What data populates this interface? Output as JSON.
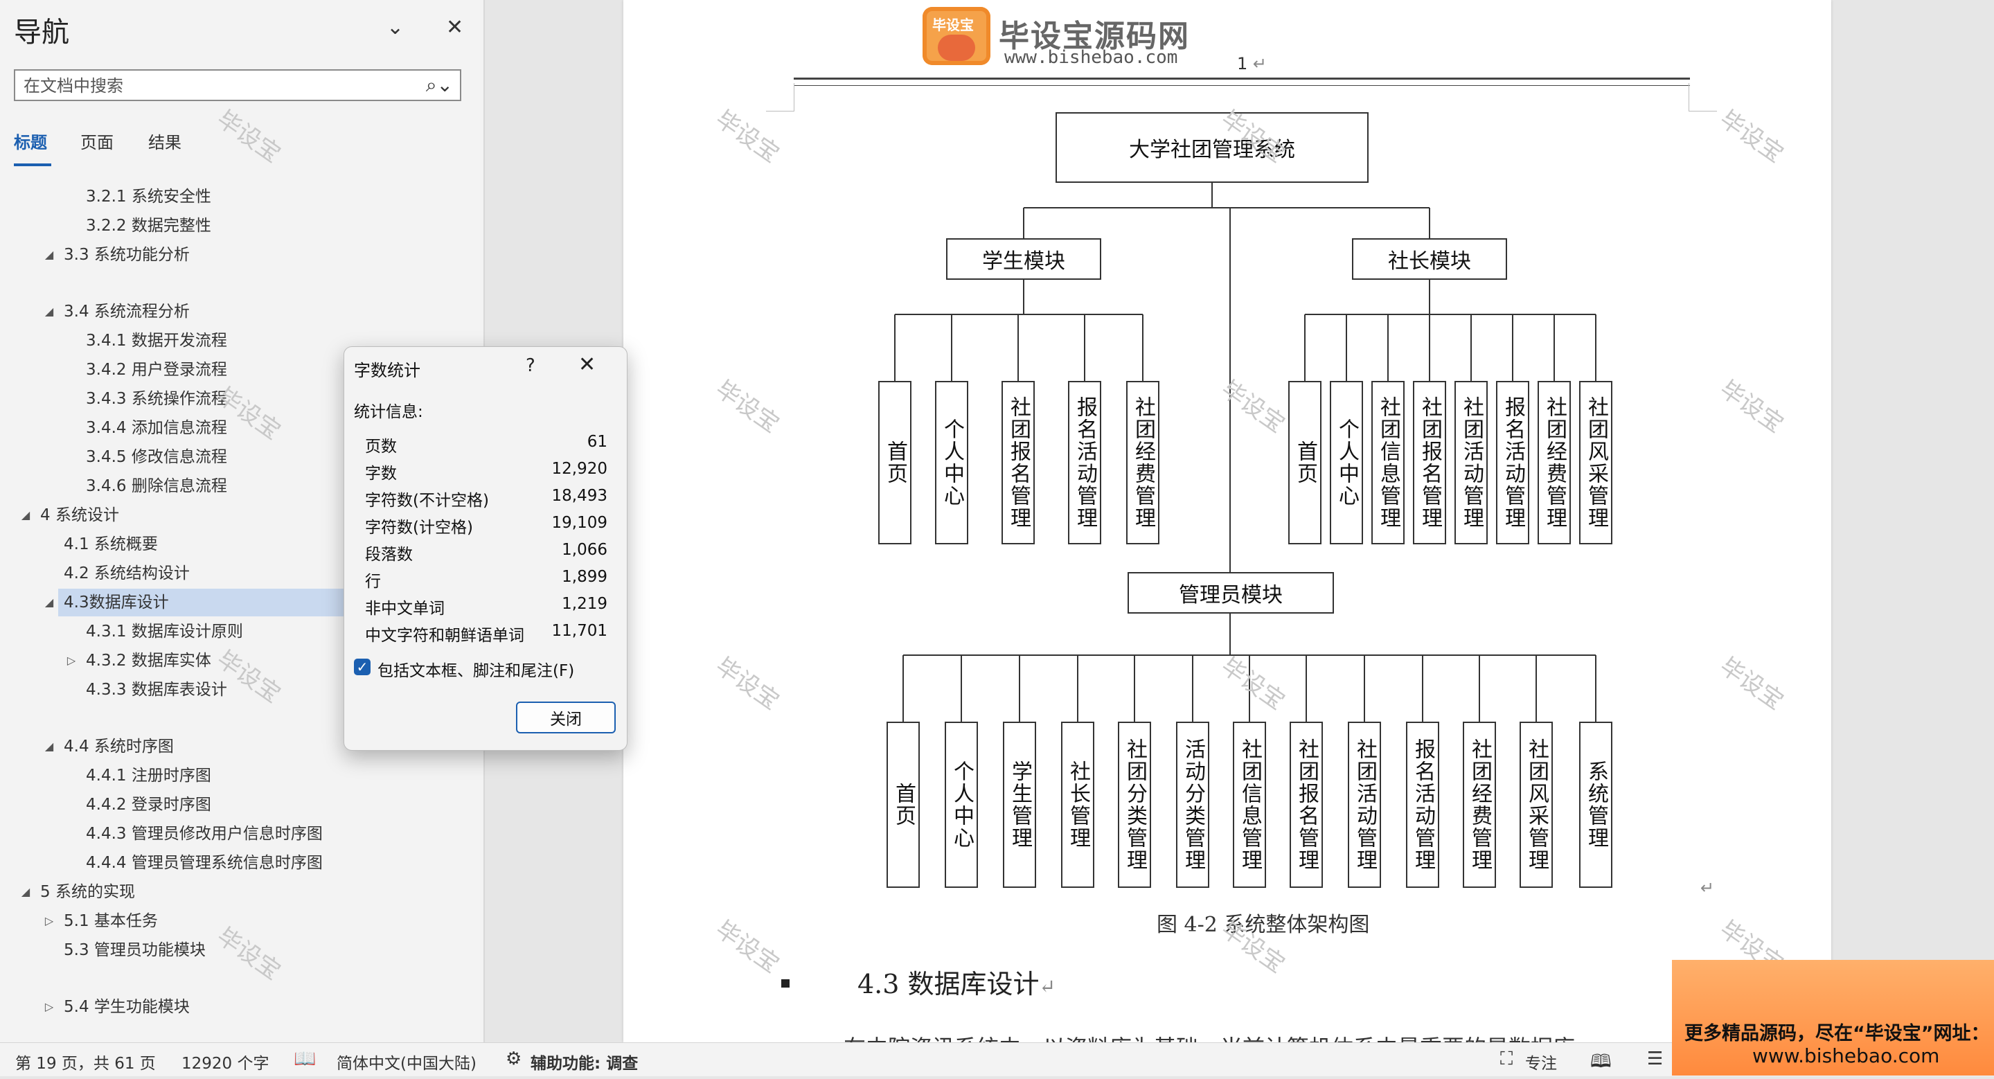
{
  "nav": {
    "title": "导航",
    "search_placeholder": "在文档中搜索",
    "tabs": [
      "标题",
      "页面",
      "结果"
    ],
    "outline": [
      {
        "level": 3,
        "label": "3.2.1 系统安全性"
      },
      {
        "level": 3,
        "label": "3.2.2 数据完整性"
      },
      {
        "level": 2,
        "label": "3.3 系统功能分析",
        "toggle": "expanded"
      },
      {
        "level": 2,
        "label": "3.4 系统流程分析",
        "toggle": "expanded"
      },
      {
        "level": 3,
        "label": "3.4.1 数据开发流程"
      },
      {
        "level": 3,
        "label": "3.4.2 用户登录流程"
      },
      {
        "level": 3,
        "label": "3.4.3 系统操作流程"
      },
      {
        "level": 3,
        "label": "3.4.4 添加信息流程"
      },
      {
        "level": 3,
        "label": "3.4.5 修改信息流程"
      },
      {
        "level": 3,
        "label": "3.4.6 删除信息流程"
      },
      {
        "level": 1,
        "label": "4 系统设计",
        "toggle": "expanded"
      },
      {
        "level": 2,
        "label": "4.1 系统概要"
      },
      {
        "level": 2,
        "label": "4.2 系统结构设计"
      },
      {
        "level": 2,
        "label": "4.3数据库设计",
        "toggle": "expanded",
        "selected": true
      },
      {
        "level": 3,
        "label": "4.3.1 数据库设计原则"
      },
      {
        "level": 3,
        "label": "4.3.2 数据库实体",
        "toggle": "collapsed"
      },
      {
        "level": 3,
        "label": "4.3.3 数据库表设计"
      },
      {
        "level": 2,
        "label": "4.4 系统时序图",
        "toggle": "expanded"
      },
      {
        "level": 3,
        "label": "4.4.1 注册时序图"
      },
      {
        "level": 3,
        "label": "4.4.2 登录时序图"
      },
      {
        "level": 3,
        "label": "4.4.3 管理员修改用户信息时序图"
      },
      {
        "level": 3,
        "label": "4.4.4 管理员管理系统信息时序图"
      },
      {
        "level": 1,
        "label": "5 系统的实现",
        "toggle": "expanded"
      },
      {
        "level": 2,
        "label": "5.1 基本任务",
        "toggle": "collapsed"
      },
      {
        "level": 2,
        "label": "5.3 管理员功能模块"
      },
      {
        "level": 2,
        "label": "5.4 学生功能模块",
        "toggle": "collapsed"
      }
    ]
  },
  "dialog": {
    "title": "字数统计",
    "help": "?",
    "stat_heading": "统计信息:",
    "stats": [
      {
        "label": "页数",
        "value": "61"
      },
      {
        "label": "字数",
        "value": "12,920"
      },
      {
        "label": "字符数(不计空格)",
        "value": "18,493"
      },
      {
        "label": "字符数(计空格)",
        "value": "19,109"
      },
      {
        "label": "段落数",
        "value": "1,066"
      },
      {
        "label": "行",
        "value": "1,899"
      },
      {
        "label": "非中文单词",
        "value": "1,219"
      },
      {
        "label": "中文字符和朝鲜语单词",
        "value": "11,701"
      }
    ],
    "checkbox_label": "包括文本框、脚注和尾注(F)",
    "checkbox_checked": true,
    "close_button": "关闭"
  },
  "document": {
    "header_logo_badge": "毕设宝",
    "header_logo_title": "毕设宝源码网",
    "header_logo_url": "www.bishebao.com",
    "page_number": "1",
    "diagram": {
      "root": "大学社团管理系统",
      "student_module": "学生模块",
      "student_items": [
        "首页",
        "个人中心",
        "社团报名管理",
        "报名活动管理",
        "社团经费管理"
      ],
      "president_module": "社长模块",
      "president_items": [
        "首页",
        "个人中心",
        "社团信息管理",
        "社团报名管理",
        "社团活动管理",
        "报名活动管理",
        "社团经费管理",
        "社团风采管理"
      ],
      "admin_module": "管理员模块",
      "admin_items": [
        "首页",
        "个人中心",
        "学生管理",
        "社长管理",
        "社团分类管理",
        "活动分类管理",
        "社团信息管理",
        "社团报名管理",
        "社团活动管理",
        "报名活动管理",
        "社团经费管理",
        "社团风采管理",
        "系统管理"
      ]
    },
    "figure_caption": "图 4-2  系统整体架构图",
    "section_heading": "4.3 数据库设计",
    "body_text": "在中院资讯系统中，以资料库为基础，当前计算机体系中最重要的是数据库",
    "watermark": "毕设宝"
  },
  "status_bar": {
    "page_info": "第 19 页，共 61 页",
    "word_count": "12920 个字",
    "language": "简体中文(中国大陆)",
    "accessibility": "辅助功能: 调查",
    "focus": "专注"
  },
  "promo": {
    "line1": "更多精品源码，尽在“毕设宝”网址：",
    "line2": "www.bishebao.com"
  }
}
